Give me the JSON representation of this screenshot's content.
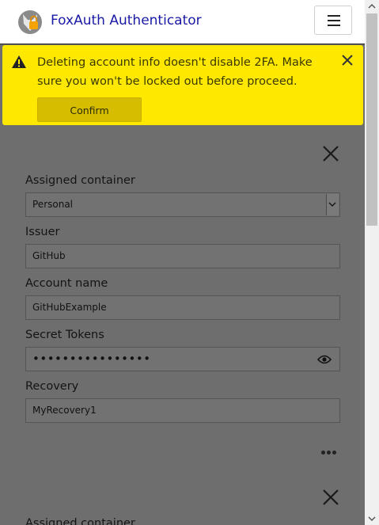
{
  "app": {
    "title": "FoxAuth Authenticator"
  },
  "banner": {
    "message": "Deleting account info doesn't disable 2FA. Make sure you won't be locked out before proceed.",
    "confirm_label": "Confirm"
  },
  "form": {
    "container_label": "Assigned container",
    "container_value": "Personal",
    "issuer_label": "Issuer",
    "issuer_value": "GitHub",
    "account_label": "Account name",
    "account_value": "GitHubExample",
    "secret_label": "Secret Tokens",
    "secret_value": "••••••••••••••••",
    "recovery_label": "Recovery",
    "recovery_value": "MyRecovery1"
  },
  "next_card": {
    "container_label": "Assigned container"
  },
  "colors": {
    "banner": "#ffe800",
    "title": "#1a1aa6",
    "overlay": "#6e6e6e"
  }
}
